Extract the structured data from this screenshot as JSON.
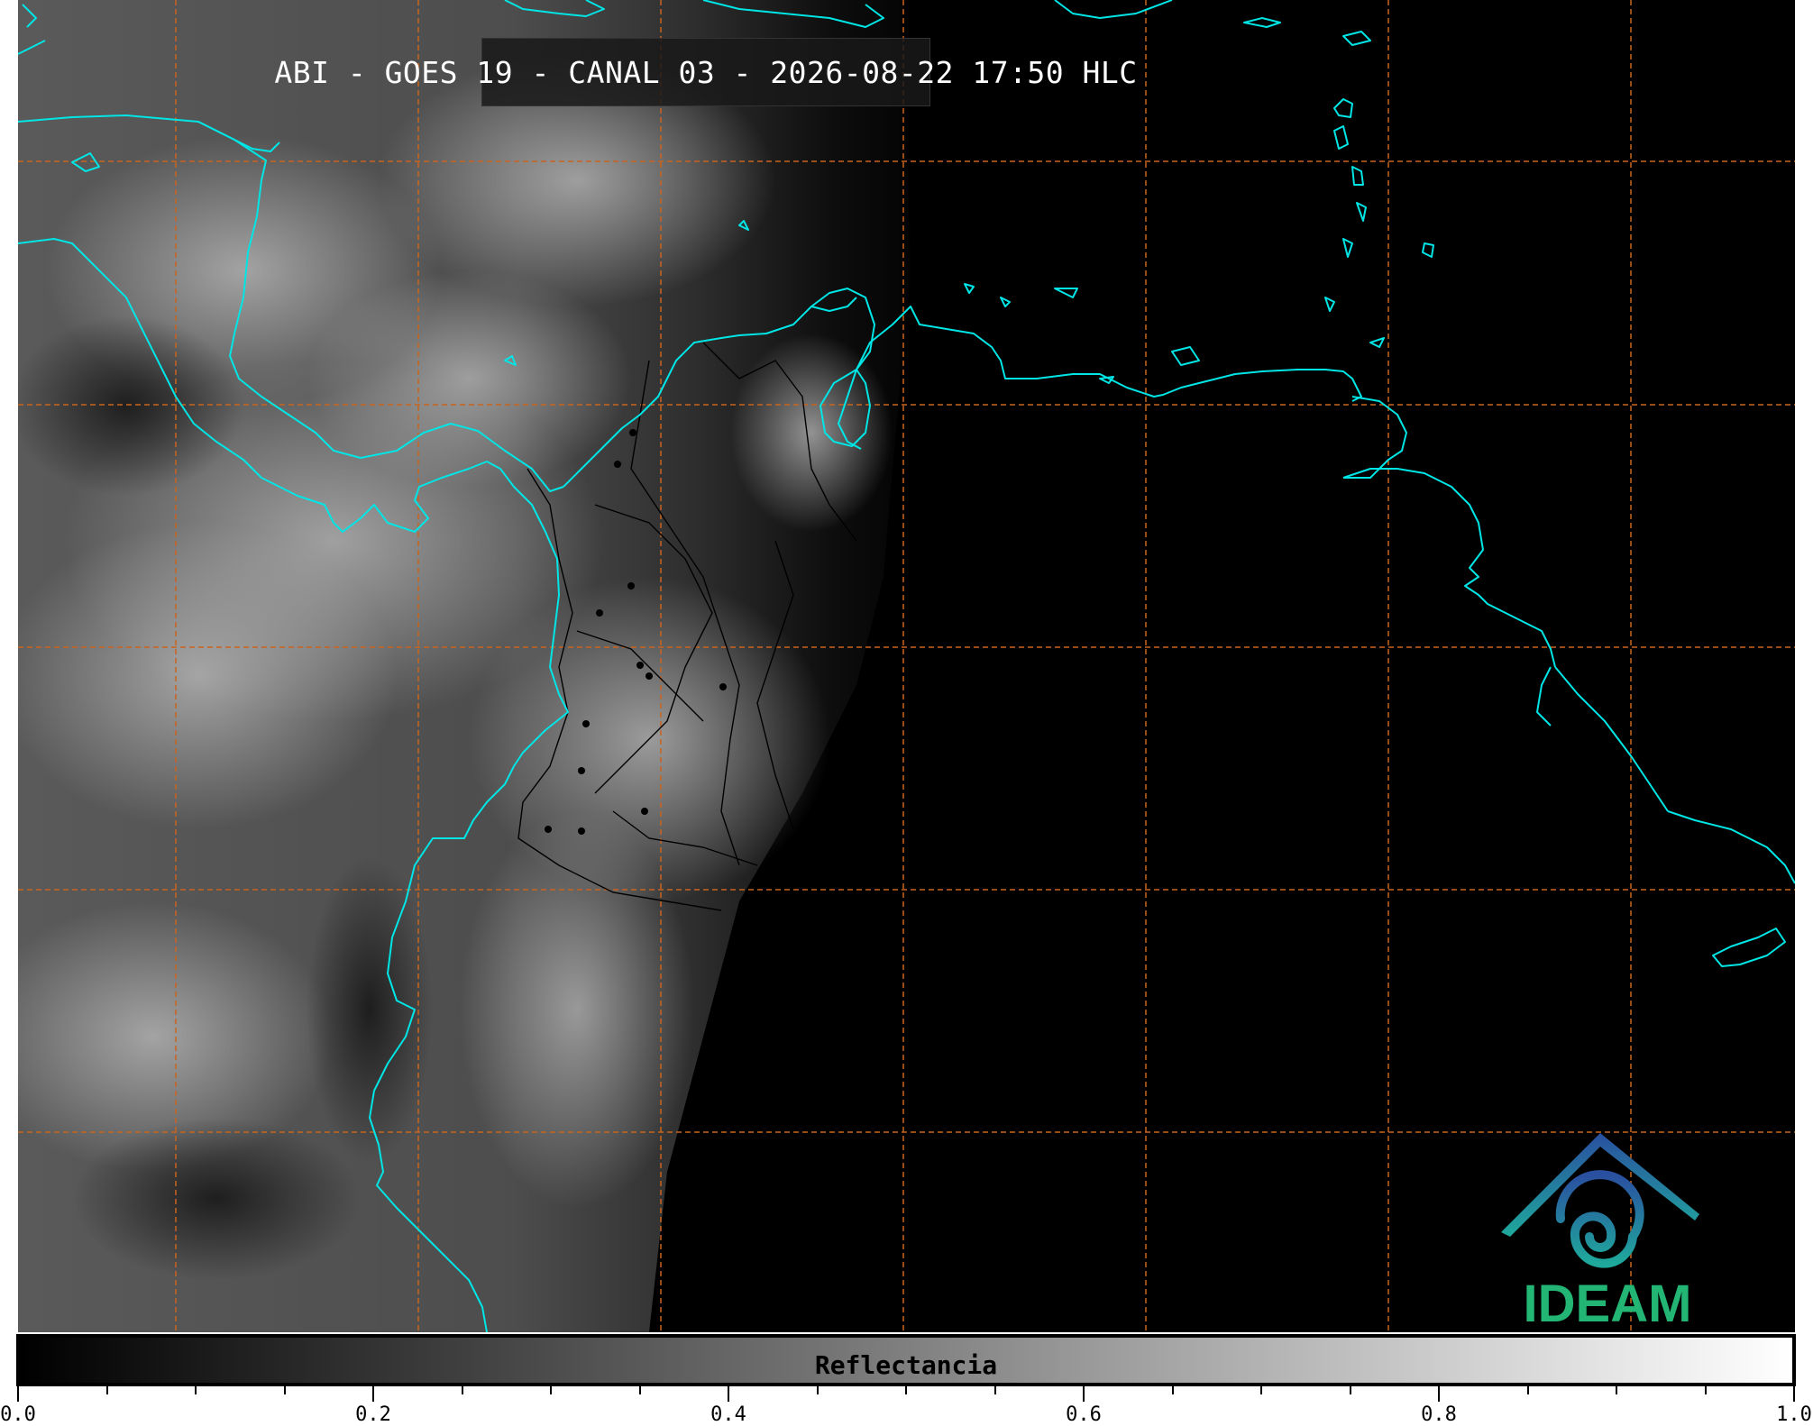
{
  "title": "ABI - GOES 19 - CANAL 03 - 2026-08-22 17:50 HLC",
  "logo": {
    "text": "IDEAM",
    "color": "#22b573"
  },
  "colorbar": {
    "label": "Reflectancia",
    "min": 0.0,
    "max": 1.0,
    "tick_labels": [
      "0.0",
      "0.2",
      "0.4",
      "0.6",
      "0.8",
      "1.0"
    ],
    "colormap": [
      "#000000",
      "#ffffff"
    ]
  },
  "colors": {
    "coastline": "#00e5e5",
    "gridlines": "#c8651e",
    "borders": "#000000"
  }
}
